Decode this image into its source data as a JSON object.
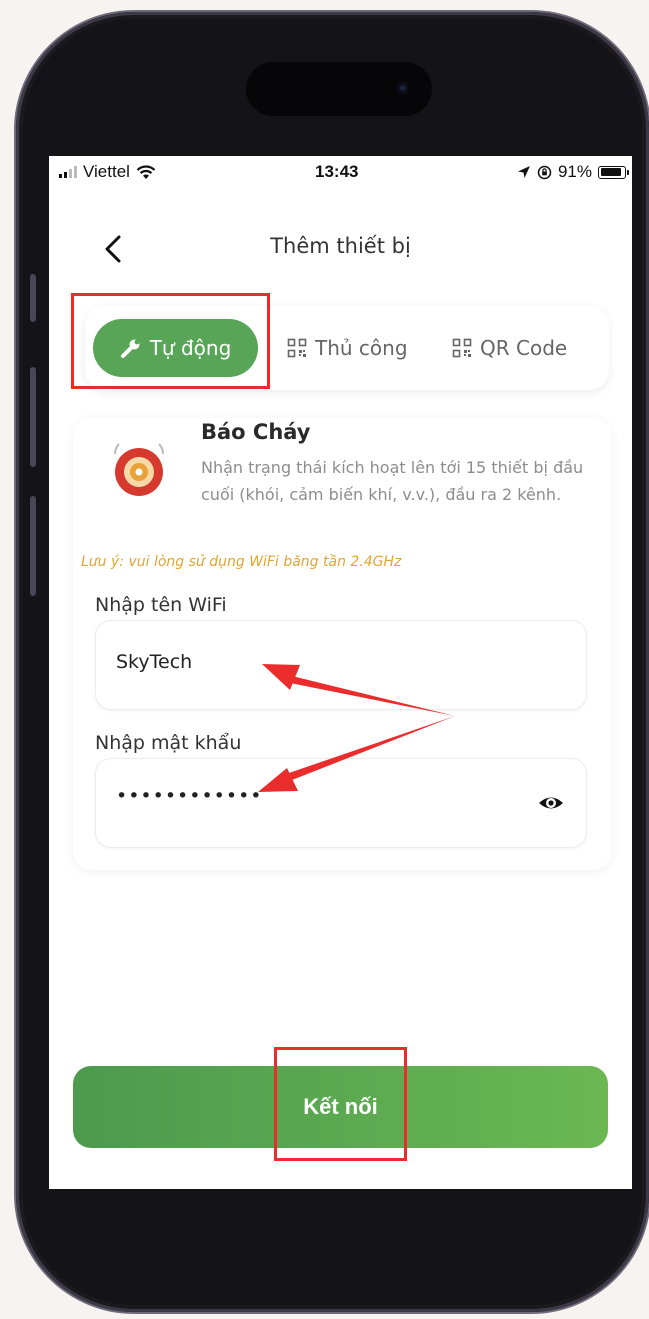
{
  "status_bar": {
    "carrier": "Viettel",
    "time": "13:43",
    "battery": "91%"
  },
  "header": {
    "title": "Thêm thiết bị"
  },
  "tabs": [
    {
      "label": "Tự động",
      "icon": "wrench-icon",
      "active": true
    },
    {
      "label": "Thủ công",
      "icon": "qr-icon",
      "active": false
    },
    {
      "label": "QR Code",
      "icon": "qr-icon",
      "active": false
    }
  ],
  "device": {
    "name": "Báo Cháy",
    "description": "Nhận trạng thái kích hoạt lên tới 15 thiết bị đầu cuối (khói, cảm biến khí, v.v.), đầu ra 2 kênh.",
    "icon": "fire-alarm-icon"
  },
  "note": "Lưu ý: vui lòng sử dụng WiFi băng tần 2.4GHz",
  "wifi": {
    "ssid_label": "Nhập tên WiFi",
    "ssid_value": "SkyTech",
    "password_label": "Nhập mật khẩu",
    "password_value": "••••••••••••"
  },
  "connect_button": {
    "label": "Kết nối"
  },
  "colors": {
    "accent": "#58a558",
    "note": "#e0a531",
    "annotation": "#ea2c2c"
  }
}
